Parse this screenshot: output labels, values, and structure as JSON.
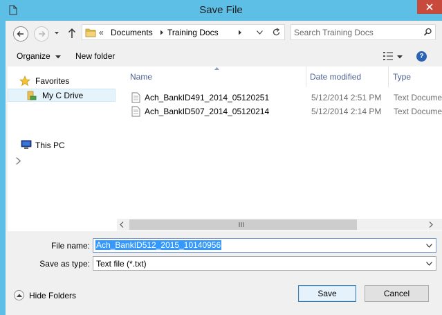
{
  "window": {
    "title": "Save File"
  },
  "address": {
    "overflow": "«",
    "crumbs": [
      "Documents",
      "Training Docs"
    ]
  },
  "search": {
    "placeholder": "Search Training Docs"
  },
  "toolbar": {
    "organize_label": "Organize",
    "new_folder_label": "New folder"
  },
  "nav_pane": {
    "items": [
      {
        "label": "Favorites",
        "icon": "star-icon"
      },
      {
        "label": "My C Drive",
        "icon": "drive-icon",
        "selected": true
      },
      {
        "label": "This PC",
        "icon": "computer-icon"
      }
    ]
  },
  "file_list": {
    "columns": [
      "Name",
      "Date modified",
      "Type"
    ],
    "rows": [
      {
        "name": "Ach_BankID491_2014_05120251",
        "date": "5/12/2014 2:51 PM",
        "type": "Text Document"
      },
      {
        "name": "Ach_BankID507_2014_05120214",
        "date": "5/12/2014 2:14 PM",
        "type": "Text Document"
      }
    ]
  },
  "form": {
    "file_name_label": "File name:",
    "file_name_value": "Ach_BankID512_2015_10140956",
    "save_type_label": "Save as type:",
    "save_type_value": "Text file (*.txt)"
  },
  "footer": {
    "hide_folders_label": "Hide Folders",
    "save_label": "Save",
    "cancel_label": "Cancel"
  },
  "colors": {
    "frame": "#5ebfe6",
    "close": "#c74a3c",
    "selection": "#3399ff",
    "header_text": "#4c5f8e"
  }
}
